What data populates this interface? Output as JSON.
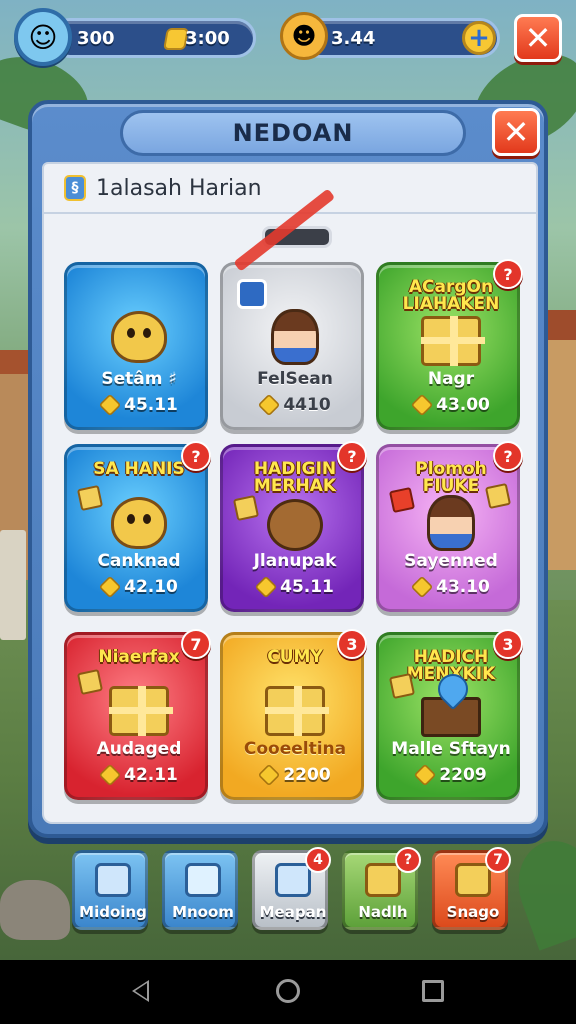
{
  "hud": {
    "resource_1": "300",
    "resource_2": "3:00",
    "resource_3": "3.44",
    "plus_icon": "plus-icon",
    "close_label": "✕"
  },
  "dialog": {
    "title": "NEDOAN",
    "close_label": "✕",
    "subtitle": "1alasah Harian"
  },
  "cards": [
    {
      "header": "",
      "badge": "",
      "name": "Setâm ♯",
      "price": "45.11",
      "theme": "blue",
      "art": "critter-icon"
    },
    {
      "header": "",
      "badge": "",
      "name": "FelSean",
      "price": "4410",
      "theme": "grey",
      "art": "person-icon"
    },
    {
      "header": "ACargOn LIAHAKEN",
      "badge": "?",
      "name": "Nagr",
      "price": "43.00",
      "theme": "green",
      "art": "chest-icon"
    },
    {
      "header": "SA HANIS",
      "badge": "?",
      "name": "Canknad",
      "price": "42.10",
      "theme": "blue",
      "art": "critter-icon"
    },
    {
      "header": "HADIGIN MERHAK",
      "badge": "?",
      "name": "Jlanupak",
      "price": "45.11",
      "theme": "purple",
      "art": "beaver-icon"
    },
    {
      "header": "Plomoh FIUKE",
      "badge": "?",
      "name": "Sayenned",
      "price": "43.10",
      "theme": "pink",
      "art": "person-icon"
    },
    {
      "header": "Niaerfax",
      "badge": "7",
      "name": "Audaged",
      "price": "42.11",
      "theme": "red",
      "art": "chest-icon"
    },
    {
      "header": "CUMY",
      "badge": "3",
      "name": "Cooeeltina",
      "price": "2200",
      "theme": "yellow",
      "art": "chest-icon"
    },
    {
      "header": "HADICH MENXKIK",
      "badge": "3",
      "name": "Malle Sftayn",
      "price": "2209",
      "theme": "green",
      "art": "anvil-icon"
    }
  ],
  "tabs": [
    {
      "label": "Midoing",
      "badge": "",
      "theme": "blue",
      "icon": "cube-icon"
    },
    {
      "label": "Mnoom",
      "badge": "",
      "theme": "blue",
      "icon": "ice-cube-icon"
    },
    {
      "label": "Meapan",
      "badge": "4",
      "theme": "grey",
      "icon": "cube-icon"
    },
    {
      "label": "Nadlh",
      "badge": "?",
      "theme": "green",
      "icon": "chest-icon"
    },
    {
      "label": "Snago",
      "badge": "7",
      "theme": "orange",
      "icon": "chest-icon"
    }
  ]
}
